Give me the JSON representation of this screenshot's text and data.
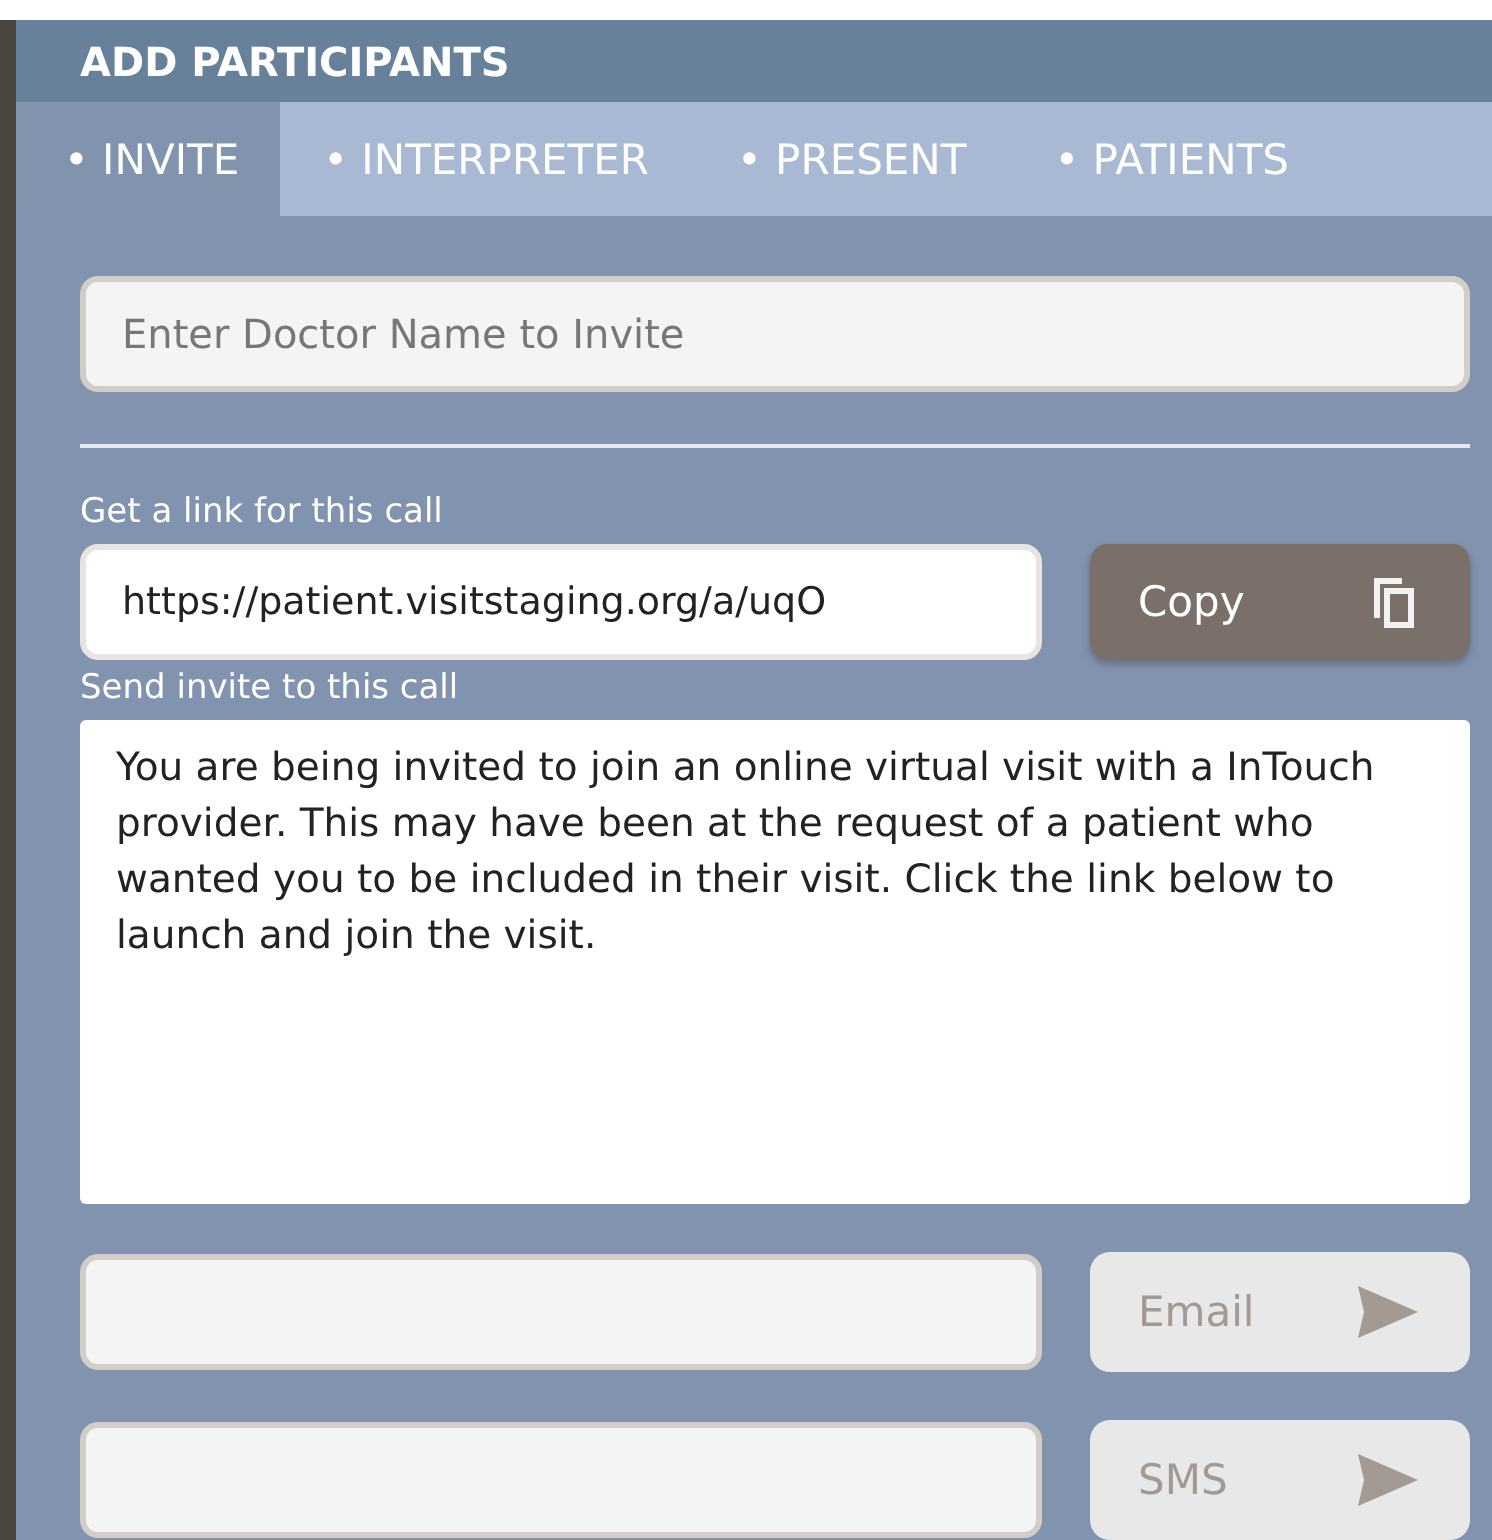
{
  "header": {
    "title": "ADD PARTICIPANTS"
  },
  "tabs": [
    {
      "label": "• INVITE",
      "selected": true
    },
    {
      "label": "• INTERPRETER",
      "selected": false
    },
    {
      "label": "• PRESENT",
      "selected": false
    },
    {
      "label": "• PATIENTS",
      "selected": false
    }
  ],
  "doctor_search": {
    "placeholder": "Enter Doctor Name to Invite"
  },
  "link": {
    "label": "Get a link for this call",
    "value": "https://patient.visitstaging.org/a/uqO",
    "button": {
      "label": "Copy"
    }
  },
  "invite": {
    "label": "Send invite to this call",
    "message": "You are being invited to join an online virtual visit with a InTouch provider. This may have been at the request of a patient who wanted you to be included in their visit. Click the link below to launch and join the visit."
  },
  "send_rows": [
    {
      "button": "Email",
      "disabled": true
    },
    {
      "button": "SMS",
      "disabled": true
    }
  ]
}
